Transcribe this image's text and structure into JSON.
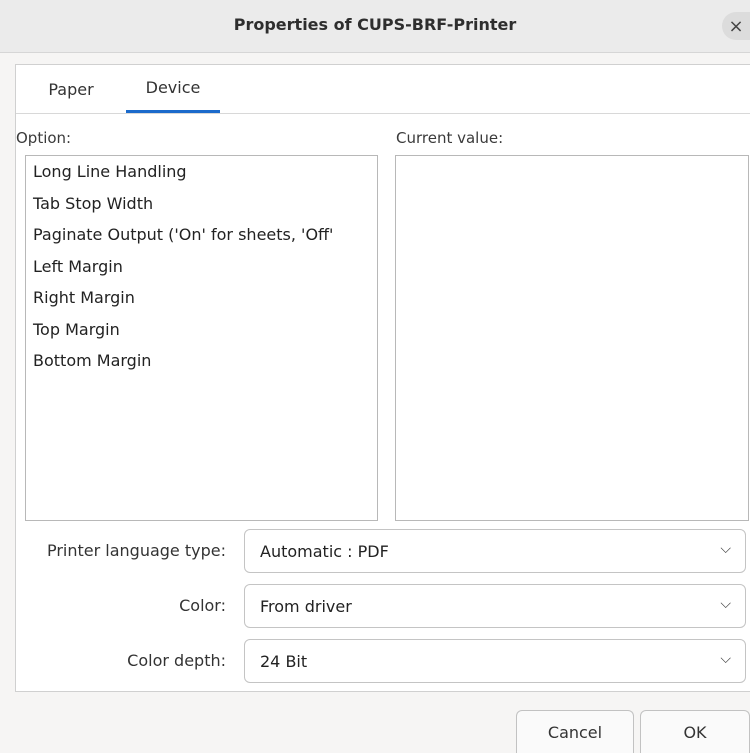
{
  "window": {
    "title": "Properties of CUPS-BRF-Printer",
    "close_icon": "×"
  },
  "tabs": [
    {
      "label": "Paper",
      "active": false
    },
    {
      "label": "Device",
      "active": true
    }
  ],
  "option_header": "Option:",
  "value_header": "Current value:",
  "options": [
    "Long Line Handling",
    "Tab Stop Width",
    "Paginate Output ('On' for sheets, 'Off'",
    "Left Margin",
    "Right Margin",
    "Top Margin",
    "Bottom Margin"
  ],
  "fields": {
    "printer_language": {
      "label": "Printer language type:",
      "value": "Automatic : PDF"
    },
    "color": {
      "label": "Color:",
      "value": "From driver"
    },
    "color_depth": {
      "label": "Color depth:",
      "value": "24 Bit"
    }
  },
  "chevron": "⌵",
  "buttons": {
    "cancel": "Cancel",
    "ok": "OK"
  }
}
